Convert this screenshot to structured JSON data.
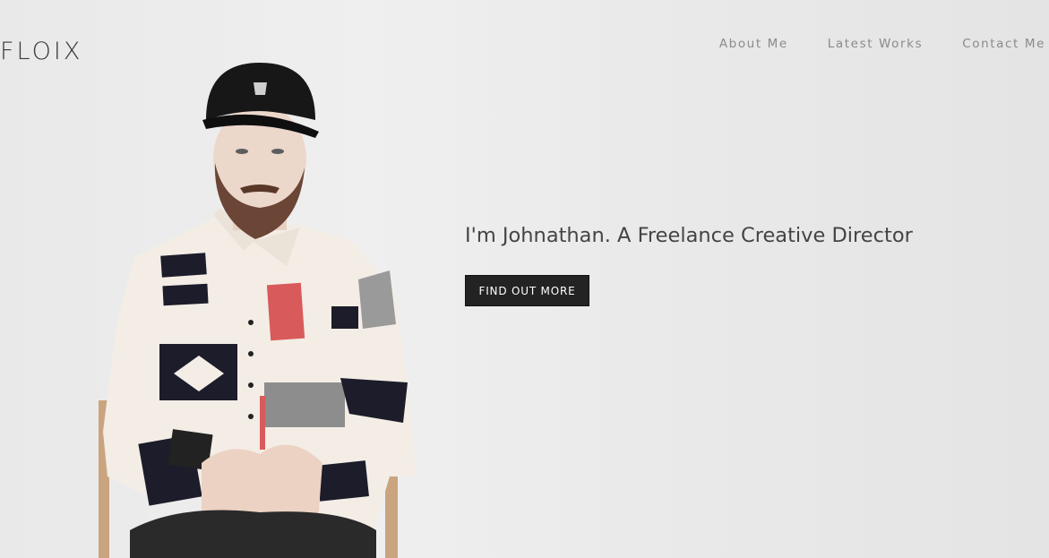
{
  "brand": {
    "logo_text": "FLOIX"
  },
  "nav": {
    "items": [
      {
        "label": "About Me"
      },
      {
        "label": "Latest Works"
      },
      {
        "label": "Contact Me"
      }
    ]
  },
  "hero": {
    "headline": "I'm Johnathan. A Freelance Creative Director",
    "cta_label": "FIND OUT MORE",
    "image": "portrait-photo"
  },
  "colors": {
    "background": "#ececec",
    "button_bg": "#232323",
    "button_text": "#ffffff",
    "nav_text": "#8a8a8a",
    "headline_text": "#444444"
  }
}
